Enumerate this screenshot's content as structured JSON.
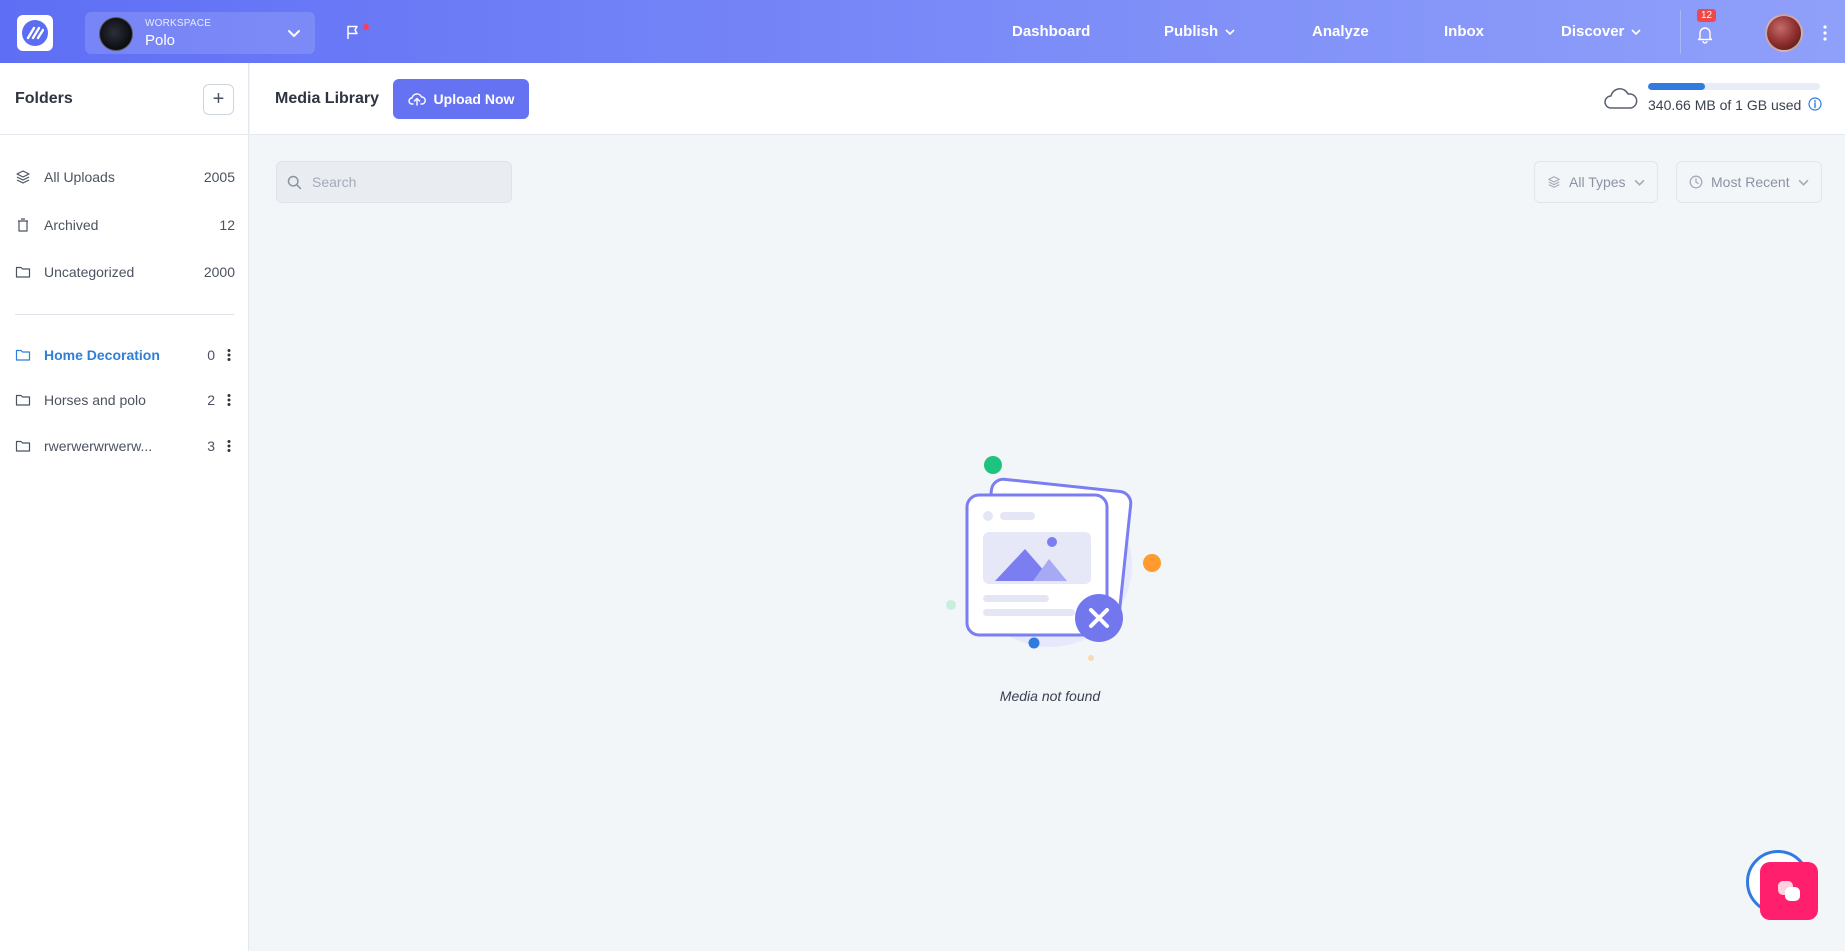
{
  "topbar": {
    "workspace_caption": "WORKSPACE",
    "workspace_name": "Polo",
    "nav": [
      "Dashboard",
      "Publish",
      "Analyze",
      "Inbox",
      "Discover"
    ],
    "notifications_count": "12",
    "icons": [
      "logo-icon",
      "chevron-down-icon",
      "flag-icon",
      "bell-icon",
      "avatar",
      "kebab-icon"
    ]
  },
  "sidebar": {
    "title": "Folders",
    "add_label": "+",
    "system_folders": [
      {
        "label": "All Uploads",
        "count": "2005",
        "icon": "layers-icon"
      },
      {
        "label": "Archived",
        "count": "12",
        "icon": "trash-icon"
      },
      {
        "label": "Uncategorized",
        "count": "2000",
        "icon": "folder-icon"
      }
    ],
    "user_folders": [
      {
        "label": "Home Decoration",
        "count": "0",
        "active": true
      },
      {
        "label": "Horses and polo",
        "count": "2",
        "active": false
      },
      {
        "label": "rwerwerwrwerw...",
        "count": "3",
        "active": false
      }
    ]
  },
  "header": {
    "title": "Media Library",
    "upload_label": "Upload Now",
    "storage_text": "340.66 MB of 1 GB used",
    "storage_used_fraction": 0.33
  },
  "toolbar": {
    "search_placeholder": "Search",
    "type_filter": "All Types",
    "sort_filter": "Most Recent"
  },
  "empty_state": {
    "message": "Media not found"
  },
  "colors": {
    "accent": "#6573f3",
    "active_folder": "#2f7ed8",
    "chat_fab": "#ff1f6d"
  }
}
